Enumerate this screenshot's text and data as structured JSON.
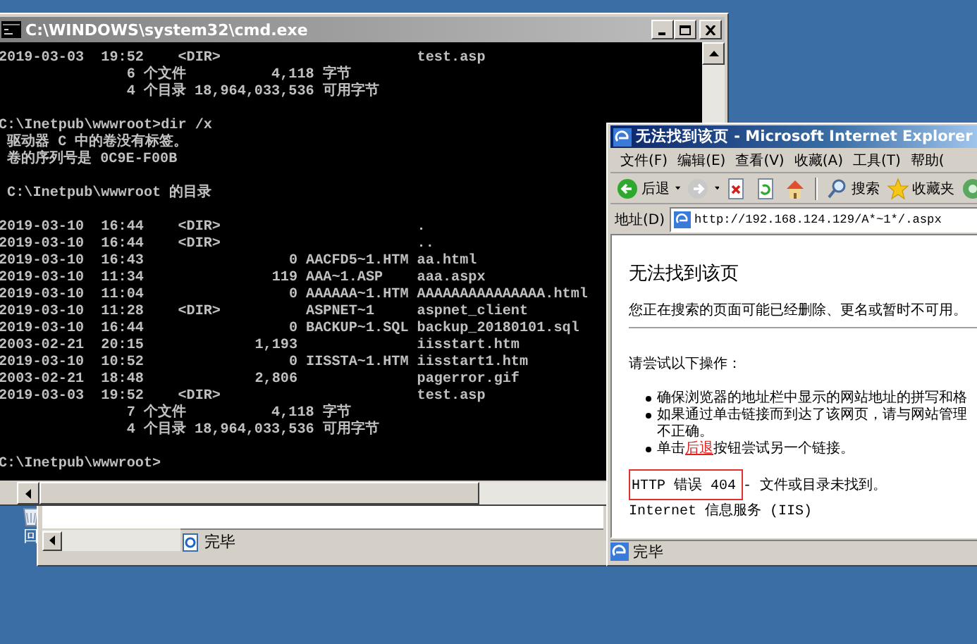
{
  "desktop": {
    "icon_label": "回"
  },
  "background_window": {
    "status": "完毕"
  },
  "cmd_window": {
    "title": "C:\\WINDOWS\\system32\\cmd.exe",
    "blocks": [
      [
        "2019-03-03  19:52    <DIR>                       test.asp",
        "               6 个文件          4,118 字节",
        "               4 个目录 18,964,033,536 可用字节"
      ],
      [
        "C:\\Inetpub\\wwwroot>dir /x",
        " 驱动器 C 中的卷没有标签。",
        " 卷的序列号是 0C9E-F00B"
      ],
      [
        " C:\\Inetpub\\wwwroot 的目录"
      ],
      [
        "2019-03-10  16:44    <DIR>                       .",
        "2019-03-10  16:44    <DIR>                       ..",
        "2019-03-10  16:43                 0 AACFD5~1.HTM aa.html",
        "2019-03-10  11:34               119 AAA~1.ASP    aaa.aspx",
        "2019-03-10  11:04                 0 AAAAAA~1.HTM AAAAAAAAAAAAAAA.html",
        "2019-03-10  11:28    <DIR>          ASPNET~1     aspnet_client",
        "2019-03-10  16:44                 0 BACKUP~1.SQL backup_20180101.sql",
        "2003-02-21  20:15             1,193              iisstart.htm",
        "2019-03-10  10:52                 0 IISSTA~1.HTM iisstart1.htm",
        "2003-02-21  18:48             2,806              pagerror.gif",
        "2019-03-03  19:52    <DIR>                       test.asp",
        "               7 个文件          4,118 字节",
        "               4 个目录 18,964,033,536 可用字节"
      ],
      [
        "C:\\Inetpub\\wwwroot>"
      ]
    ]
  },
  "ie_window": {
    "title": "无法找到该页 - Microsoft Internet Explorer",
    "menu": [
      "文件(F)",
      "编辑(E)",
      "查看(V)",
      "收藏(A)",
      "工具(T)",
      "帮助("
    ],
    "toolbar": [
      {
        "kind": "back",
        "label": "后退"
      },
      {
        "kind": "forward"
      },
      {
        "kind": "stop"
      },
      {
        "kind": "refresh"
      },
      {
        "kind": "home"
      },
      {
        "kind": "search",
        "label": "搜索"
      },
      {
        "kind": "favorites",
        "label": "收藏夹"
      },
      {
        "kind": "media"
      }
    ],
    "address": {
      "label": "地址(D)",
      "value": "http://192.168.124.129/A*~1*/.aspx"
    },
    "page": {
      "heading": "无法找到该页",
      "intro": "您正在搜索的页面可能已经删除、更名或暂时不可用。",
      "try_heading": "请尝试以下操作：",
      "bullets": [
        {
          "parts": [
            {
              "kind": "text",
              "text": "确保浏览器的地址栏中显示的网站地址的拼写和格"
            }
          ]
        },
        {
          "parts": [
            {
              "kind": "text",
              "text": "如果通过单击链接而到达了该网页，请与网站管理"
            }
          ],
          "continuation": "不正确。"
        },
        {
          "parts": [
            {
              "kind": "text",
              "text": "单击"
            },
            {
              "kind": "link",
              "text": "后退"
            },
            {
              "kind": "text",
              "text": "按钮尝试另一个链接。"
            }
          ]
        }
      ],
      "error": {
        "code": "HTTP 错误 404",
        "message": " - 文件或目录未找到。",
        "highlighted": true
      },
      "footer": "Internet 信息服务 (IIS)"
    },
    "status": "完毕"
  }
}
